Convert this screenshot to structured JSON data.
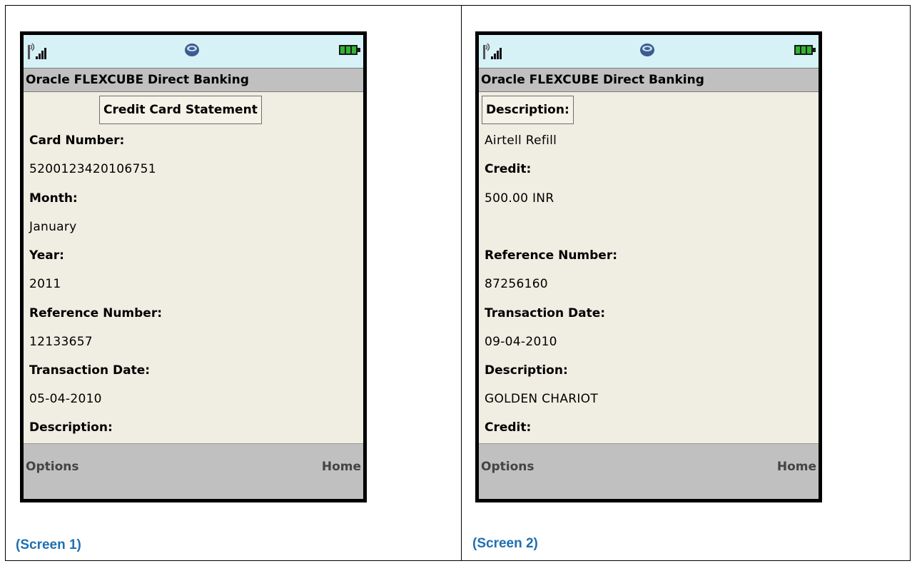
{
  "screens": [
    {
      "app_title": "Oracle FLEXCUBE Direct Banking",
      "heading": "Credit Card Statement",
      "fields": [
        {
          "label": "Card Number:",
          "value": "5200123420106751"
        },
        {
          "label": "Month:",
          "value": "January"
        },
        {
          "label": "Year:",
          "value": "2011"
        },
        {
          "label": "Reference Number:",
          "value": "12133657"
        },
        {
          "label": "Transaction Date:",
          "value": "05-04-2010"
        },
        {
          "label": "Description:",
          "value": ""
        }
      ],
      "softkeys": {
        "left": "Options",
        "right": "Home"
      },
      "caption": "(Screen 1)"
    },
    {
      "app_title": "Oracle FLEXCUBE Direct Banking",
      "focused_label": "Description:",
      "fields": [
        {
          "label": "",
          "value": "Airtell Refill"
        },
        {
          "label": "Credit:",
          "value": "500.00 INR"
        },
        {
          "label": "Reference Number:",
          "value": "87256160"
        },
        {
          "label": "Transaction Date:",
          "value": "09-04-2010"
        },
        {
          "label": "Description:",
          "value": "GOLDEN CHARIOT"
        },
        {
          "label": "Credit:",
          "value": ""
        }
      ],
      "softkeys": {
        "left": "Options",
        "right": "Home"
      },
      "caption": "(Screen 2)"
    }
  ],
  "icons": {
    "signal": "signal-strength-icon",
    "java": "java-cup-icon",
    "battery": "battery-icon"
  },
  "colors": {
    "status_bar": "#d6f2f7",
    "title_bar": "#c0c0c0",
    "screen_bg": "#f0ede2",
    "caption": "#1f6fb0"
  }
}
